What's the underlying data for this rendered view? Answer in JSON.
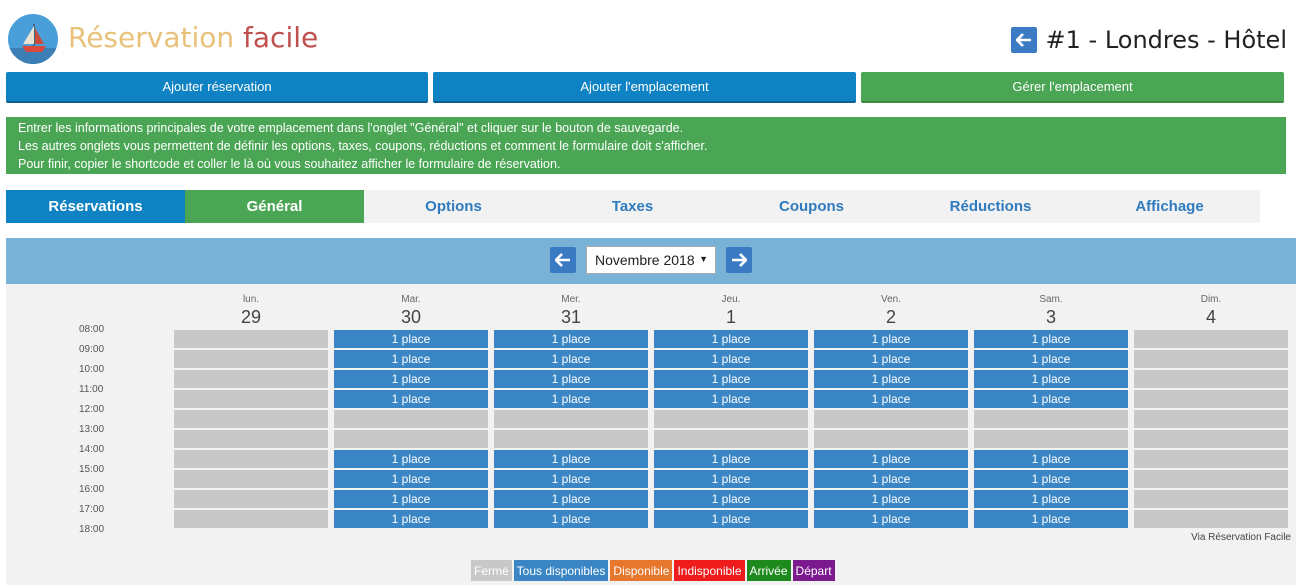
{
  "brand": {
    "word1": "Réservation",
    "word2": "facile"
  },
  "header": {
    "title": "#1 - Londres - Hôtel"
  },
  "actions": {
    "add_reservation": "Ajouter réservation",
    "add_location": "Ajouter l'emplacement",
    "manage_location": "Gérer l'emplacement"
  },
  "info": {
    "line1": "Entrer les informations principales de votre emplacement dans l'onglet \"Général\" et cliquer sur le bouton de sauvegarde.",
    "line2": "Les autres onglets vous permettent de définir les options, taxes, coupons, réductions et comment le formulaire doit s'afficher.",
    "line3": "Pour finir, copier le shortcode et coller le là où vous souhaitez afficher le formulaire de réservation."
  },
  "tabs": [
    "Réservations",
    "Général",
    "Options",
    "Taxes",
    "Coupons",
    "Réductions",
    "Affichage"
  ],
  "calendar": {
    "month": "Novembre 2018",
    "days": [
      {
        "name": "lun.",
        "num": "29",
        "closed": true
      },
      {
        "name": "Mar.",
        "num": "30",
        "closed": false
      },
      {
        "name": "Mer.",
        "num": "31",
        "closed": false
      },
      {
        "name": "Jeu.",
        "num": "1",
        "closed": false
      },
      {
        "name": "Ven.",
        "num": "2",
        "closed": false
      },
      {
        "name": "Sam.",
        "num": "3",
        "closed": false
      },
      {
        "name": "Dim.",
        "num": "4",
        "closed": true
      }
    ],
    "times": [
      "08:00",
      "09:00",
      "10:00",
      "11:00",
      "12:00",
      "13:00",
      "14:00",
      "15:00",
      "16:00",
      "17:00",
      "18:00"
    ],
    "slot_states": [
      "avail",
      "avail",
      "avail",
      "avail",
      "closed",
      "closed",
      "avail",
      "avail",
      "avail",
      "avail"
    ],
    "slot_label": "1 place",
    "via": "Via Réservation Facile"
  },
  "legend": [
    {
      "label": "Fermé",
      "color": "#c8c8c8"
    },
    {
      "label": "Tous disponibles",
      "color": "#3a86c4"
    },
    {
      "label": "Disponible",
      "color": "#e8772e"
    },
    {
      "label": "Indisponible",
      "color": "#ee1c1c"
    },
    {
      "label": "Arrivée",
      "color": "#1e8a1e"
    },
    {
      "label": "Départ",
      "color": "#7b1a8f"
    }
  ]
}
